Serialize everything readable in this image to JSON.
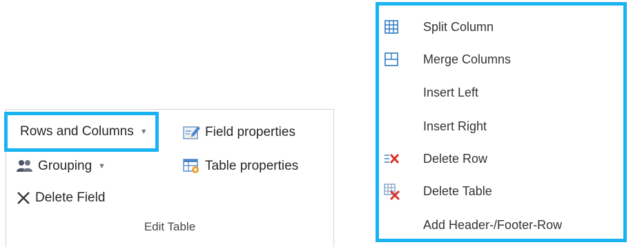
{
  "ribbon": {
    "rows_columns_label": "Rows and Columns",
    "grouping_label": "Grouping",
    "delete_field_label": "Delete Field",
    "field_properties_label": "Field properties",
    "table_properties_label": "Table properties",
    "group_label": "Edit Table"
  },
  "menu": {
    "items": [
      {
        "label": "Split Column",
        "icon": "split-column-icon"
      },
      {
        "label": "Merge Columns",
        "icon": "merge-columns-icon"
      },
      {
        "label": "Insert Left",
        "icon": ""
      },
      {
        "label": "Insert Right",
        "icon": ""
      },
      {
        "label": "Delete Row",
        "icon": "delete-row-icon"
      },
      {
        "label": "Delete Table",
        "icon": "delete-table-icon"
      },
      {
        "label": "Add Header-/Footer-Row",
        "icon": ""
      }
    ]
  },
  "colors": {
    "highlight": "#19b3f1",
    "icon_blue": "#2b78c5",
    "delete_red": "#d9332b"
  }
}
